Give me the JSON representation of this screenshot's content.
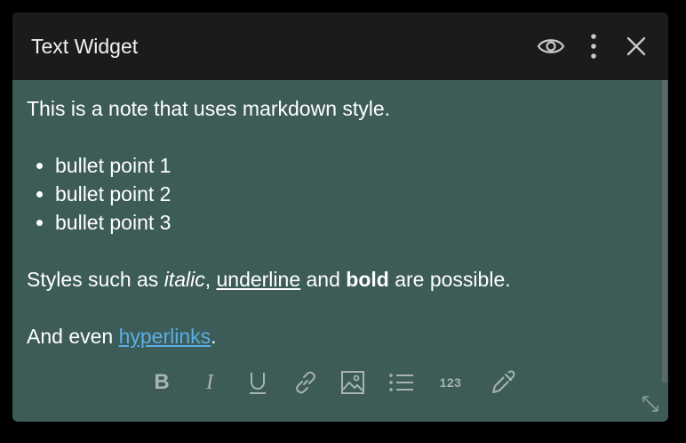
{
  "header": {
    "title": "Text Widget"
  },
  "content": {
    "intro": "This is a note that uses markdown style.",
    "bullets": [
      "bullet point 1",
      "bullet point 2",
      "bullet point 3"
    ],
    "styles_prefix": "Styles such as ",
    "styles_italic": "italic",
    "styles_comma": ", ",
    "styles_underline": "underline",
    "styles_and": " and ",
    "styles_bold": "bold",
    "styles_suffix": " are possible.",
    "links_prefix": "And even ",
    "links_text": "hyperlinks",
    "links_suffix": "."
  },
  "toolbar": {
    "bold_label": "B",
    "italic_label": "I",
    "numbered_label": "123"
  },
  "colors": {
    "header_bg": "#1b1b1b",
    "body_bg": "#3d5c58",
    "link": "#5aaee8",
    "toolbar_icon": "#a9b3b1"
  }
}
